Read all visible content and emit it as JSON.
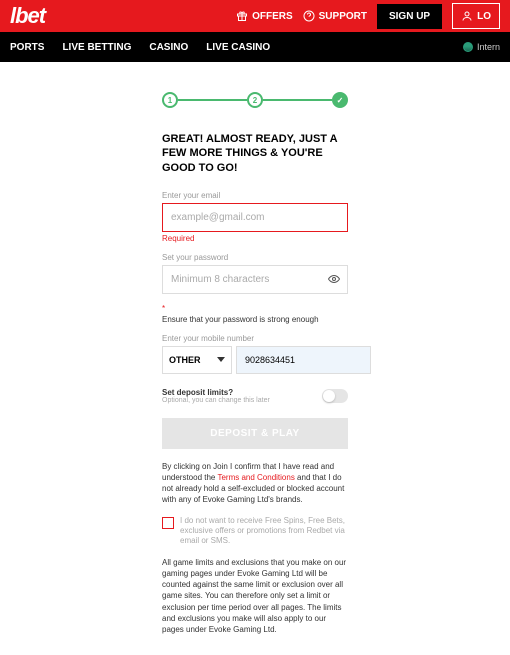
{
  "header": {
    "logo": "lbet",
    "offers": "OFFERS",
    "support": "SUPPORT",
    "signup": "SIGN UP",
    "login": "LO",
    "language": "Intern"
  },
  "nav": {
    "items": [
      "PORTS",
      "LIVE BETTING",
      "CASINO",
      "LIVE CASINO"
    ]
  },
  "steps": {
    "s1": "1",
    "s2": "2",
    "s3": "✓"
  },
  "heading": "GREAT! ALMOST READY, JUST A FEW MORE THINGS & YOU'RE GOOD TO GO!",
  "email": {
    "label": "Enter your email",
    "placeholder": "example@gmail.com",
    "error": "Required"
  },
  "password": {
    "label": "Set your password",
    "placeholder": "Minimum 8 characters",
    "hint": "Ensure that your password is strong enough"
  },
  "mobile": {
    "label": "Enter your mobile number",
    "country": "OTHER",
    "value": "9028634451"
  },
  "deposit": {
    "label": "Set deposit limits?",
    "sub": "Optional, you can change this later"
  },
  "submit": "DEPOSIT & PLAY",
  "terms_pre": "By clicking on Join I confirm that I have read and understood the ",
  "terms_link": "Terms and Conditions",
  "terms_post": " and that I do not already hold a self-excluded or blocked account with any of Evoke Gaming Ltd's brands.",
  "optin": "I do not want to receive Free Spins, Free Bets, exclusive offers or promotions from Redbet via email or SMS.",
  "limits": "All game limits and exclusions that you make on our gaming pages under Evoke Gaming Ltd will be counted against the same limit or exclusion over all game sites. You can therefore only set a limit or exclusion per time period over all pages. The limits and exclusions you make will also apply to our pages under Evoke Gaming Ltd."
}
